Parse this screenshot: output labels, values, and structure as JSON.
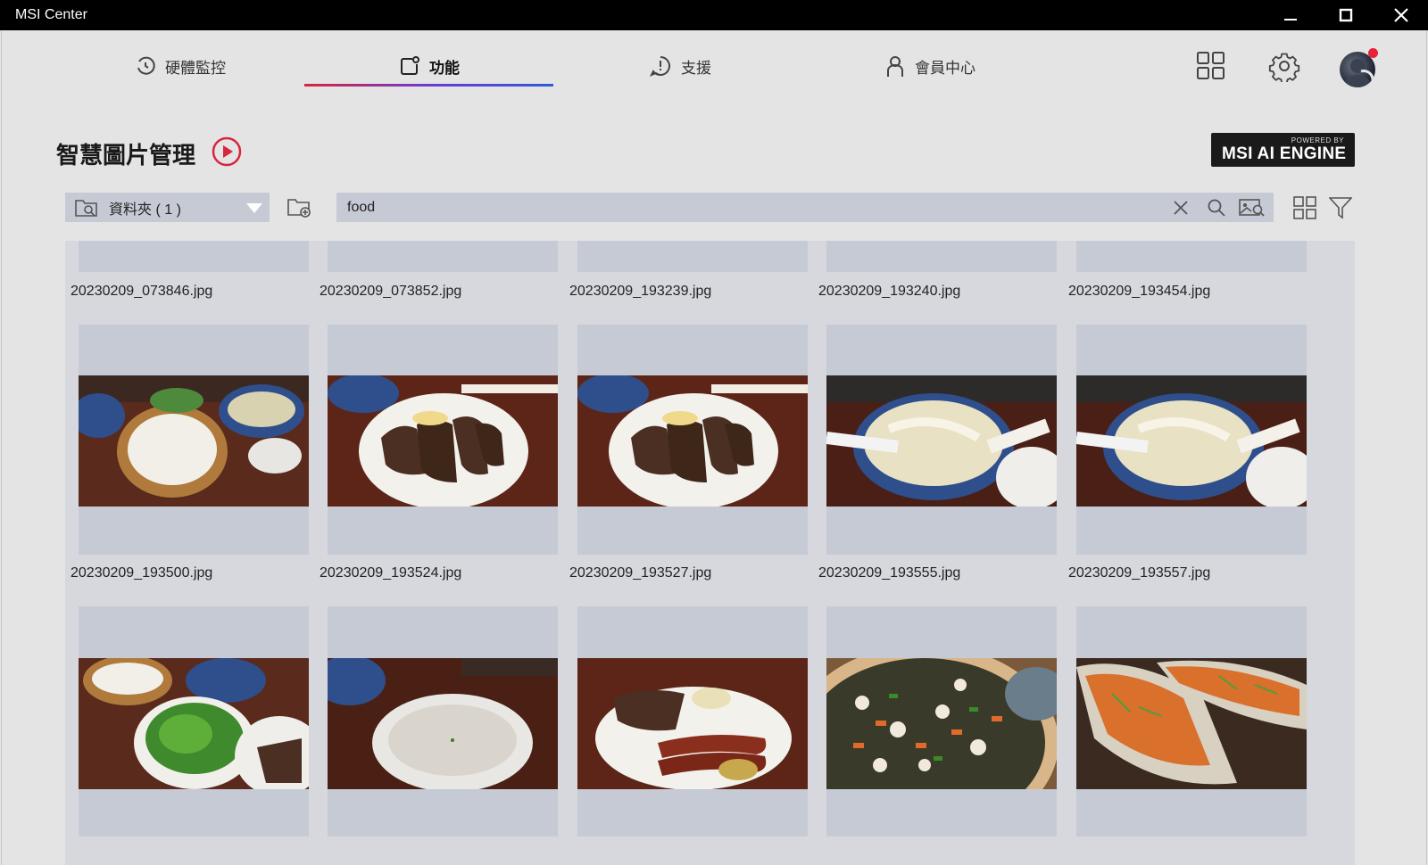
{
  "window": {
    "title": "MSI Center"
  },
  "nav": {
    "tabs": [
      {
        "label": "硬體監控",
        "icon": "gauge-icon"
      },
      {
        "label": "功能",
        "icon": "feature-icon",
        "active": true
      },
      {
        "label": "支援",
        "icon": "support-icon"
      },
      {
        "label": "會員中心",
        "icon": "user-icon"
      }
    ],
    "accent": "#d7263d"
  },
  "page": {
    "title": "智慧圖片管理",
    "badge_small": "POWERED BY",
    "badge_big": "MSI AI ENGINE"
  },
  "toolbar": {
    "folder_label": "資料夾 ( 1 )",
    "search_value": "food"
  },
  "gallery": {
    "files": [
      "20230209_073846.jpg",
      "20230209_073852.jpg",
      "20230209_193239.jpg",
      "20230209_193240.jpg",
      "20230209_193454.jpg",
      "20230209_193500.jpg",
      "20230209_193524.jpg",
      "20230209_193527.jpg",
      "20230209_193555.jpg",
      "20230209_193557.jpg"
    ]
  }
}
